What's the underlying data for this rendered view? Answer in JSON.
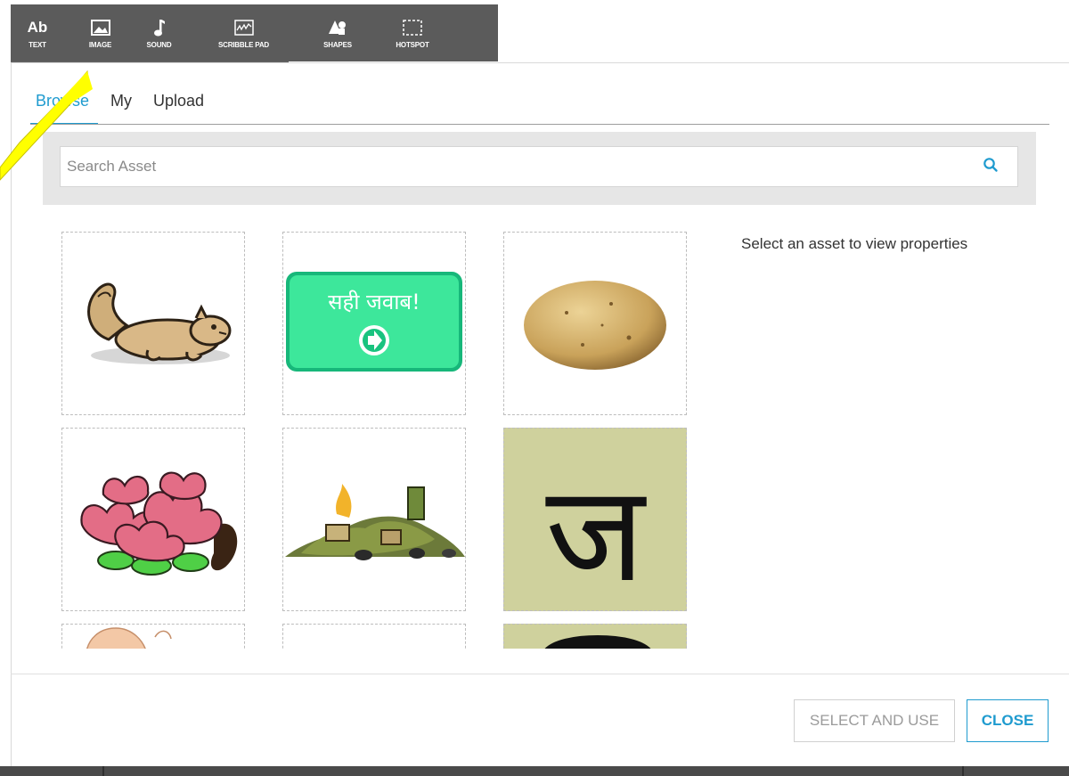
{
  "toolbar": {
    "items": [
      {
        "id": "text",
        "label": "TEXT",
        "icon": "text-icon",
        "glyph": "Ab"
      },
      {
        "id": "image",
        "label": "IMAGE",
        "icon": "image-icon"
      },
      {
        "id": "sound",
        "label": "SOUND",
        "icon": "music-note-icon"
      },
      {
        "id": "scribble",
        "label": "SCRIBBLE PAD",
        "icon": "scribble-pad-icon"
      },
      {
        "id": "shapes",
        "label": "SHAPES",
        "icon": "shapes-icon"
      },
      {
        "id": "hotspot",
        "label": "HOTSPOT",
        "icon": "hotspot-icon"
      }
    ]
  },
  "tabs": [
    {
      "label": "Browse",
      "active": true
    },
    {
      "label": "My",
      "active": false
    },
    {
      "label": "Upload",
      "active": false
    }
  ],
  "search": {
    "placeholder": "Search Asset",
    "value": "",
    "icon": "search-icon"
  },
  "assets": [
    {
      "name": "squirrel",
      "icon": "squirrel-image"
    },
    {
      "name": "correct-answer-button",
      "icon": "correct-answer-button-image",
      "text": "सही जवाब!"
    },
    {
      "name": "potato",
      "icon": "potato-image"
    },
    {
      "name": "lotus",
      "icon": "lotus-image"
    },
    {
      "name": "garbage-pile",
      "icon": "garbage-pile-image"
    },
    {
      "name": "letter-ja",
      "icon": "hindi-letter-image",
      "text": "ज"
    },
    {
      "name": "face",
      "icon": "face-image"
    },
    {
      "name": "blank",
      "icon": "blank-image"
    },
    {
      "name": "letter-partial",
      "icon": "hindi-letter-image"
    }
  ],
  "properties": {
    "message": "Select an asset to view properties"
  },
  "footer": {
    "select_label": "SELECT AND USE",
    "close_label": "CLOSE"
  },
  "colors": {
    "accent": "#1f9bcf",
    "toolbar": "#5b5b5b",
    "highlight_arrow": "#ffff00",
    "button_green": "#3de79b",
    "olive_card": "#cfd19d"
  }
}
